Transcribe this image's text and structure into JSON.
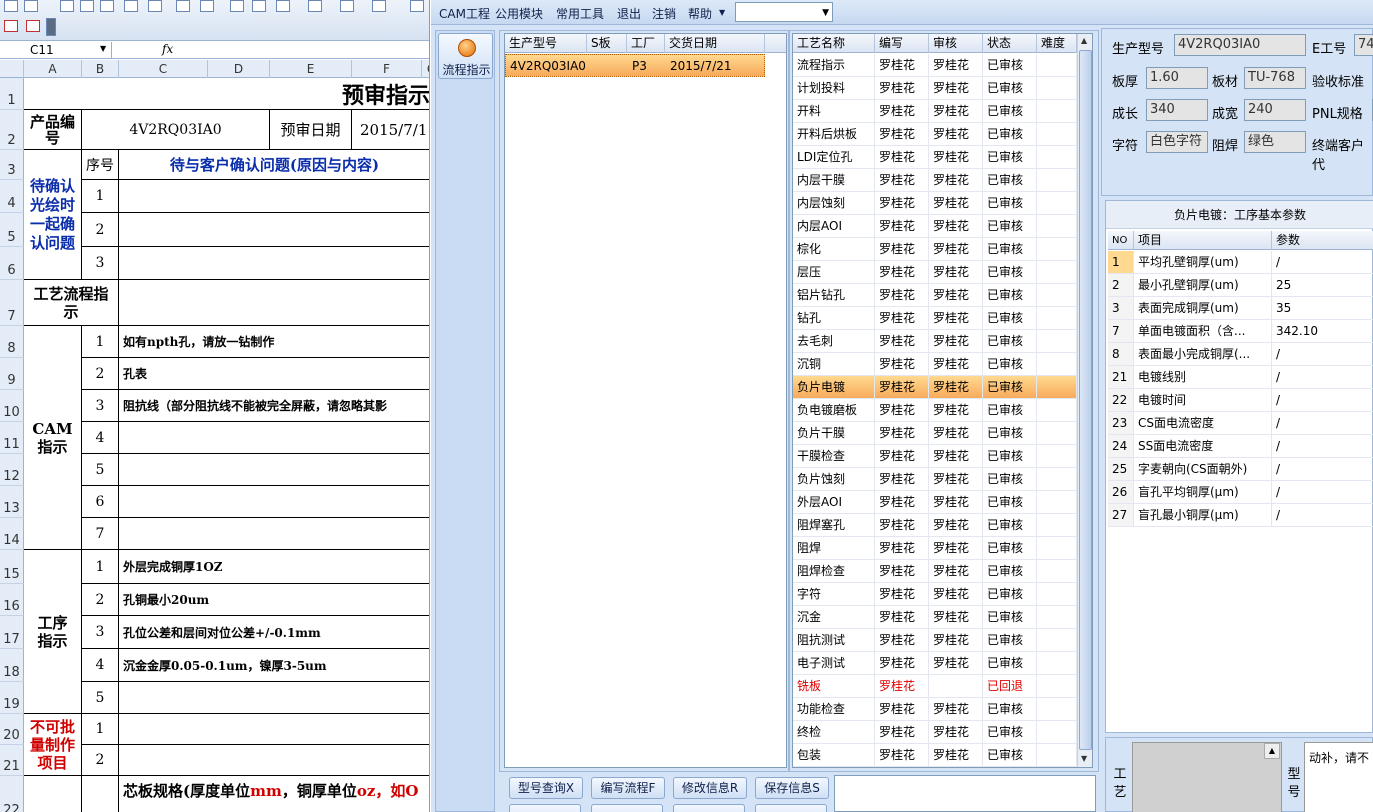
{
  "excel": {
    "name_box": "C11",
    "fx": "fx",
    "columns": [
      "A",
      "B",
      "C",
      "D",
      "E",
      "F",
      "G"
    ],
    "rows": [
      "1",
      "2",
      "3",
      "4",
      "5",
      "6",
      "7",
      "8",
      "9",
      "10",
      "11",
      "12",
      "13",
      "14",
      "15",
      "16",
      "17",
      "18",
      "19",
      "20",
      "21",
      "22"
    ],
    "title": "预审指示",
    "product_no_label": "产品编号",
    "product_no": "4V2RQ03IA0",
    "review_date_label": "预审日期",
    "review_date": "2015/7/1",
    "seq_label": "序号",
    "confirm_header": "待与客户确认问题(原因与内容)",
    "confirm_group": "待确认光绘时一起确认问题",
    "confirm_nums": [
      "1",
      "2",
      "3"
    ],
    "process_label": "工艺流程指示",
    "cam_label": "CAM指示",
    "cam_nums": [
      "1",
      "2",
      "3",
      "4",
      "5",
      "6",
      "7"
    ],
    "cam_items": [
      "如有npth孔，请放一钻制作",
      "孔表",
      "阻抗线（部分阻抗线不能被完全屏蔽，请忽略其影",
      "",
      "",
      "",
      ""
    ],
    "proc_label": "工序指示",
    "proc_nums": [
      "1",
      "2",
      "3",
      "4",
      "5"
    ],
    "proc_items": [
      "外层完成铜厚1OZ",
      "孔铜最小20um",
      "孔位公差和层间对位公差+/-0.1mm",
      "沉金金厚0.05-0.1um，镍厚3-5um",
      ""
    ],
    "nomass_label": "不可批量制作项目",
    "nomass_nums": [
      "1",
      "2"
    ],
    "core_spec_a": "芯板规格(厚度单位",
    "core_spec_b": "mm",
    "core_spec_c": "，铜厚单位",
    "core_spec_d": "oz",
    "core_spec_e": "，如O"
  },
  "app": {
    "menu": [
      "CAM工程",
      "公用模块",
      "常用工具",
      "退出",
      "注销",
      "帮助"
    ],
    "menu_arrow": "▼",
    "flow_button": "流程指示",
    "model_grid": {
      "headers": [
        "生产型号",
        "S板",
        "工厂",
        "交货日期"
      ],
      "rows": [
        [
          "4V2RQ03IA0",
          "",
          "P3",
          "2015/7/21"
        ]
      ]
    },
    "process_grid": {
      "headers": [
        "工艺名称",
        "编写",
        "审核",
        "状态",
        "难度"
      ],
      "rows": [
        [
          "流程指示",
          "罗桂花",
          "罗桂花",
          "已审核"
        ],
        [
          "计划投料",
          "罗桂花",
          "罗桂花",
          "已审核"
        ],
        [
          "开料",
          "罗桂花",
          "罗桂花",
          "已审核"
        ],
        [
          "开料后烘板",
          "罗桂花",
          "罗桂花",
          "已审核"
        ],
        [
          "LDI定位孔",
          "罗桂花",
          "罗桂花",
          "已审核"
        ],
        [
          "内层干膜",
          "罗桂花",
          "罗桂花",
          "已审核"
        ],
        [
          "内层蚀刻",
          "罗桂花",
          "罗桂花",
          "已审核"
        ],
        [
          "内层AOI",
          "罗桂花",
          "罗桂花",
          "已审核"
        ],
        [
          "棕化",
          "罗桂花",
          "罗桂花",
          "已审核"
        ],
        [
          "层压",
          "罗桂花",
          "罗桂花",
          "已审核"
        ],
        [
          "铝片钻孔",
          "罗桂花",
          "罗桂花",
          "已审核"
        ],
        [
          "钻孔",
          "罗桂花",
          "罗桂花",
          "已审核"
        ],
        [
          "去毛刺",
          "罗桂花",
          "罗桂花",
          "已审核"
        ],
        [
          "沉铜",
          "罗桂花",
          "罗桂花",
          "已审核"
        ],
        [
          "负片电镀",
          "罗桂花",
          "罗桂花",
          "已审核"
        ],
        [
          "负电镀磨板",
          "罗桂花",
          "罗桂花",
          "已审核"
        ],
        [
          "负片干膜",
          "罗桂花",
          "罗桂花",
          "已审核"
        ],
        [
          "干膜检查",
          "罗桂花",
          "罗桂花",
          "已审核"
        ],
        [
          "负片蚀刻",
          "罗桂花",
          "罗桂花",
          "已审核"
        ],
        [
          "外层AOI",
          "罗桂花",
          "罗桂花",
          "已审核"
        ],
        [
          "阻焊塞孔",
          "罗桂花",
          "罗桂花",
          "已审核"
        ],
        [
          "阻焊",
          "罗桂花",
          "罗桂花",
          "已审核"
        ],
        [
          "阻焊检查",
          "罗桂花",
          "罗桂花",
          "已审核"
        ],
        [
          "字符",
          "罗桂花",
          "罗桂花",
          "已审核"
        ],
        [
          "沉金",
          "罗桂花",
          "罗桂花",
          "已审核"
        ],
        [
          "阻抗测试",
          "罗桂花",
          "罗桂花",
          "已审核"
        ],
        [
          "电子测试",
          "罗桂花",
          "罗桂花",
          "已审核"
        ],
        [
          "铣板",
          "罗桂花",
          "",
          "已回退"
        ],
        [
          "功能检查",
          "罗桂花",
          "罗桂花",
          "已审核"
        ],
        [
          "终检",
          "罗桂花",
          "罗桂花",
          "已审核"
        ],
        [
          "包装",
          "罗桂花",
          "罗桂花",
          "已审核"
        ]
      ],
      "selected_index": 14,
      "returned_index": 27
    },
    "buttons": [
      "型号查询X",
      "编写流程F",
      "修改信息R",
      "保存信息S"
    ],
    "info": {
      "prod_model_label": "生产型号",
      "prod_model": "4V2RQ03IA0",
      "e_no_label": "E工号",
      "e_no": "74",
      "thickness_label": "板厚",
      "thickness": "1.60",
      "material_label": "板材",
      "material": "TU-768",
      "accept_label": "验收标准",
      "length_label": "成长",
      "length": "340",
      "width_label": "成宽",
      "width": "240",
      "pnl_label": "PNL规格",
      "char_label": "字符",
      "char": "白色字符",
      "mask_label": "阻焊",
      "mask": "绿色",
      "customer_label": "终端客户代"
    },
    "param_panel": {
      "title": "负片电镀：工序基本参数",
      "headers": [
        "NO",
        "项目",
        "参数"
      ],
      "rows": [
        [
          "1",
          "平均孔壁铜厚(um)",
          "/"
        ],
        [
          "2",
          "最小孔壁铜厚(um)",
          "25"
        ],
        [
          "3",
          "表面完成铜厚(um)",
          "35"
        ],
        [
          "7",
          "单面电镀面积（含...",
          "342.10"
        ],
        [
          "8",
          "表面最小完成铜厚(...",
          "/"
        ],
        [
          "21",
          "电镀线别",
          "/"
        ],
        [
          "22",
          "电镀时间",
          "/"
        ],
        [
          "23",
          "CS面电流密度",
          "/"
        ],
        [
          "24",
          "SS面电流密度",
          "/"
        ],
        [
          "25",
          "字麦朝向(CS面朝外)",
          "/"
        ],
        [
          "26",
          "盲孔平均铜厚(μm)",
          "/"
        ],
        [
          "27",
          "盲孔最小铜厚(μm)",
          "/"
        ]
      ]
    },
    "bottom": {
      "left_label": "工艺",
      "mid_label": "型号",
      "note": "动补，请不"
    }
  }
}
